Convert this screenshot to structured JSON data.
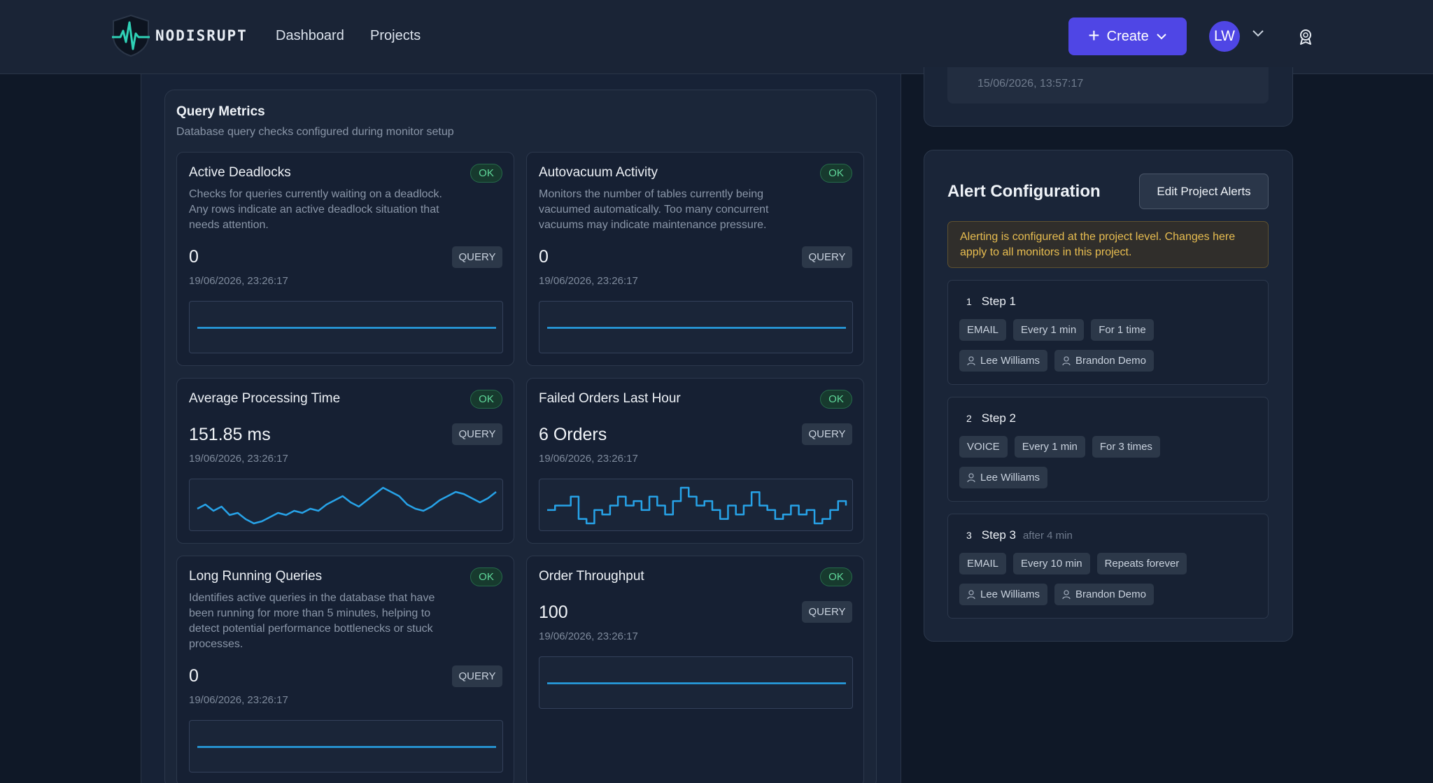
{
  "header": {
    "brand": "NODISRUPT",
    "nav": [
      "Dashboard",
      "Projects"
    ],
    "create_label": "Create",
    "avatar_initials": "LW",
    "accent": "#4f46e5"
  },
  "top_card": {
    "timestamp": "15/06/2026, 13:57:17"
  },
  "query_metrics": {
    "title": "Query Metrics",
    "subtitle": "Database query checks configured during monitor setup",
    "query_label": "QUERY",
    "ok_label": "OK",
    "cards": [
      {
        "title": "Active Deadlocks",
        "description": "Checks for queries currently waiting on a deadlock. Any rows indicate an active deadlock situation that needs attention.",
        "value": "0",
        "timestamp": "19/06/2026, 23:26:17",
        "series": [
          0,
          0,
          0,
          0,
          0,
          0,
          0,
          0,
          0,
          0
        ]
      },
      {
        "title": "Autovacuum Activity",
        "description": "Monitors the number of tables currently being vacuumed automatically. Too many concurrent vacuums may indicate maintenance pressure.",
        "value": "0",
        "timestamp": "19/06/2026, 23:26:17",
        "series": [
          0,
          0,
          0,
          0,
          0,
          0,
          0,
          0,
          0,
          0
        ]
      },
      {
        "title": "Average Processing Time",
        "description": "",
        "value": "151.85 ms",
        "timestamp": "19/06/2026, 23:26:17",
        "series": [
          150,
          152,
          149,
          151,
          147,
          148,
          145,
          143,
          144,
          146,
          148,
          147,
          149,
          148,
          150,
          149,
          152,
          154,
          156,
          153,
          151,
          154,
          157,
          160,
          158,
          156,
          152,
          150,
          149,
          151,
          154,
          156,
          158,
          157,
          155,
          153,
          155,
          158
        ]
      },
      {
        "title": "Failed Orders Last Hour",
        "description": "",
        "value": "6 Orders",
        "timestamp": "19/06/2026, 23:26:17",
        "series": [
          5,
          6,
          6,
          8,
          3,
          2,
          5,
          4,
          6,
          8,
          6,
          7,
          5,
          8,
          6,
          4,
          7,
          10,
          8,
          6,
          7,
          5,
          3,
          6,
          4,
          6,
          9,
          6,
          5,
          3,
          4,
          6,
          4,
          5,
          2,
          3,
          5,
          7,
          6
        ]
      },
      {
        "title": "Long Running Queries",
        "description": "Identifies active queries in the database that have been running for more than 5 minutes, helping to detect potential performance bottlenecks or stuck processes.",
        "value": "0",
        "timestamp": "19/06/2026, 23:26:17",
        "series": [
          0,
          0,
          0,
          0,
          0,
          0,
          0,
          0,
          0,
          0
        ]
      },
      {
        "title": "Order Throughput",
        "description": "",
        "value": "100",
        "timestamp": "19/06/2026, 23:26:17",
        "series": [
          100,
          100,
          100,
          100,
          100,
          100,
          100,
          100,
          100,
          100
        ]
      }
    ]
  },
  "alerts": {
    "title": "Alert Configuration",
    "edit_label": "Edit Project Alerts",
    "notice": "Alerting is configured at the project level. Changes here apply to all monitors in this project.",
    "steps": [
      {
        "number": "1",
        "name": "Step 1",
        "extra": "",
        "chips": [
          "EMAIL",
          "Every 1 min",
          "For 1 time"
        ],
        "users": [
          "Lee Williams",
          "Brandon Demo"
        ]
      },
      {
        "number": "2",
        "name": "Step 2",
        "extra": "",
        "chips": [
          "VOICE",
          "Every 1 min",
          "For 3 times"
        ],
        "users": [
          "Lee Williams"
        ]
      },
      {
        "number": "3",
        "name": "Step 3",
        "extra": "after 4 min",
        "chips": [
          "EMAIL",
          "Every 10 min",
          "Repeats forever"
        ],
        "users": [
          "Lee Williams",
          "Brandon Demo"
        ]
      }
    ]
  }
}
